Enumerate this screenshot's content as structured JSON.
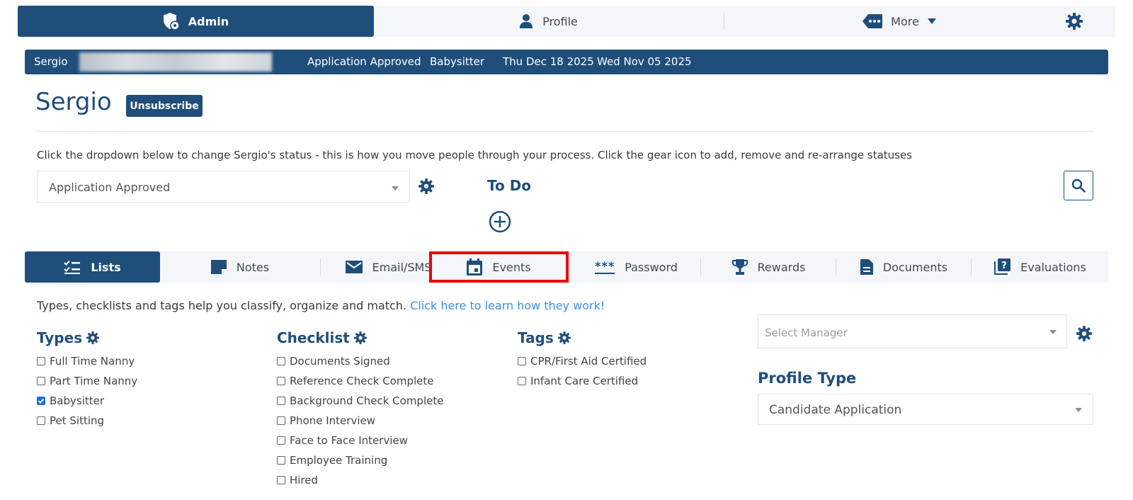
{
  "colors": {
    "primary": "#1f4e7b",
    "nav_bg": "#f4f6f9",
    "link": "#3a8ee6",
    "highlight": "#ee0000",
    "check": "#1f6fd6"
  },
  "topnav": {
    "admin": {
      "label": "Admin",
      "icon": "shield-gear-icon"
    },
    "profile": {
      "label": "Profile",
      "icon": "person-icon"
    },
    "more": {
      "label": "More",
      "icon": "tag-dots-icon"
    },
    "settings_icon": "gear-icon"
  },
  "infobar": {
    "name": "Sergio",
    "status": "Application Approved",
    "type": "Babysitter",
    "date1": "Thu Dec 18 2025",
    "date2": "Wed Nov 05 2025"
  },
  "person": {
    "name": "Sergio",
    "unsubscribe_label": "Unsubscribe"
  },
  "status": {
    "help_text": "Click the dropdown below to change Sergio's status - this is how you move people through your process. Click the gear icon to add, remove and re-arrange statuses",
    "selected": "Application Approved"
  },
  "todo": {
    "title": "To Do"
  },
  "tabs": [
    {
      "label": "Lists",
      "icon": "checklist-icon",
      "active": true
    },
    {
      "label": "Notes",
      "icon": "note-icon"
    },
    {
      "label": "Email/SMS",
      "icon": "envelope-icon"
    },
    {
      "label": "Events",
      "icon": "calendar-icon",
      "highlighted": true
    },
    {
      "label": "Password",
      "icon": "asterisks-icon"
    },
    {
      "label": "Rewards",
      "icon": "trophy-icon"
    },
    {
      "label": "Documents",
      "icon": "document-icon"
    },
    {
      "label": "Evaluations",
      "icon": "question-book-icon"
    }
  ],
  "lists": {
    "help_text": "Types, checklists and tags help you classify, organize and match.",
    "help_link": "Click here to learn how they work!",
    "types": {
      "title": "Types",
      "items": [
        {
          "label": "Full Time Nanny",
          "checked": false
        },
        {
          "label": "Part Time Nanny",
          "checked": false
        },
        {
          "label": "Babysitter",
          "checked": true
        },
        {
          "label": "Pet Sitting",
          "checked": false
        }
      ]
    },
    "checklist": {
      "title": "Checklist",
      "items": [
        {
          "label": "Documents Signed",
          "checked": false
        },
        {
          "label": "Reference Check Complete",
          "checked": false
        },
        {
          "label": "Background Check Complete",
          "checked": false
        },
        {
          "label": "Phone Interview",
          "checked": false
        },
        {
          "label": "Face to Face Interview",
          "checked": false
        },
        {
          "label": "Employee Training",
          "checked": false
        },
        {
          "label": "Hired",
          "checked": false
        }
      ]
    },
    "tags": {
      "title": "Tags",
      "items": [
        {
          "label": "CPR/First Aid Certified",
          "checked": false
        },
        {
          "label": "Infant Care Certified",
          "checked": false
        }
      ]
    }
  },
  "manager": {
    "placeholder": "Select Manager"
  },
  "profile_type": {
    "title": "Profile Type",
    "selected": "Candidate Application"
  }
}
